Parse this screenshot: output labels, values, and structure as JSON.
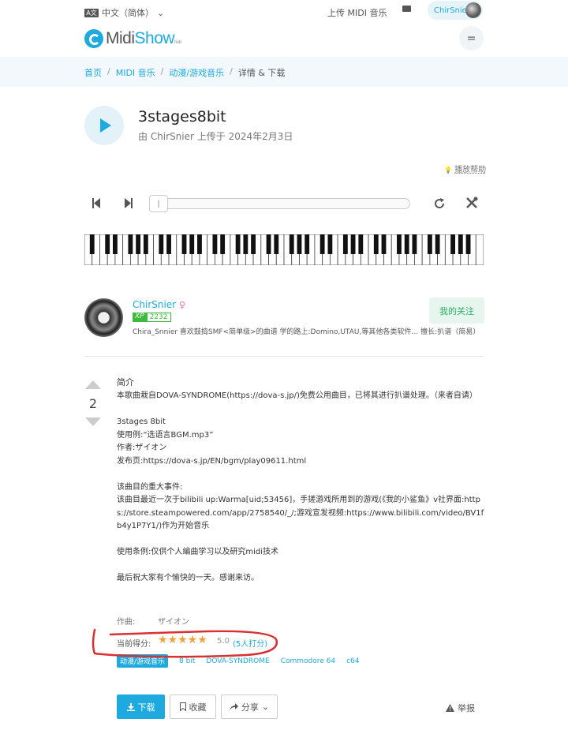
{
  "topbar": {
    "lang_icon": "A文",
    "lang_label": "中文（简体）",
    "lang_caret": "⌄",
    "upload_label": "上传 MIDI 音乐",
    "user_name": "ChirSnier"
  },
  "brand": {
    "name_a": "Midi",
    "name_b": "Show",
    "sub": "hub"
  },
  "menu_icon": "=",
  "breadcrumb": [
    "首页",
    "/",
    "MIDI 音乐",
    "/",
    "动漫/游戏音乐",
    "/",
    "详情 & 下载"
  ],
  "song": {
    "title": "3stages8bit",
    "byline": "由 ChirSnier 上传于 2024年2月3日"
  },
  "help_label": "播放帮助",
  "help_icon": "💡",
  "player": {
    "progress": 0.0,
    "white_keys": 52
  },
  "author": {
    "name": "ChirSnier",
    "gender_icon": "♀",
    "xp_tag": "XP",
    "xp_value": "2232",
    "desc": "Chira_Snnier 喜欢鼓捣SMF<简单级>的曲谱 学的路上:Domino,UTAU,等其他各类软件… 擅长:扒谱（简易）",
    "follow_label": "我的关注"
  },
  "vote_count": "2",
  "description": {
    "title": "简介",
    "body": "本歌曲栽自DOVA-SYNDROME(https://dova-s.jp/)免费公用曲目，已将其进行扒谱处理。（来者自请）\n\n3stages 8bit\n使用例:“选语言BGM.mp3”\n作者:ザイオン\n发布页:https://dova-s.jp/EN/bgm/play09611.html\n\n该曲目的重大事件:\n该曲目最近一次于bilibili up:Warma[uid;53456]，手搓游戏所用到的游戏(《我的小鲨鱼》v社界面:https://store.steampowered.com/app/2758540/_/;游戏宣发视频:https://www.bilibili.com/video/BV1fb4y1P7Y1/)作为开始音乐\n\n使用条例:仅供个人编曲学习以及研究midi技术\n\n最后祝大家有个愉快的一天。感谢来访。"
  },
  "composer": {
    "label": "作曲:",
    "value": "ザイオン"
  },
  "rating": {
    "label": "当前得分:",
    "stars": "★★★★★",
    "score": "5.0",
    "count": "(5人打分)"
  },
  "tags": [
    "动漫/游戏音乐",
    "8 bit",
    "DOVA-SYNDROME",
    "Commodore 64",
    "c64"
  ],
  "actions": {
    "download": "下载",
    "favorite": "收藏",
    "share": "分享",
    "share_caret": "⌄",
    "report": "举报"
  },
  "colors": {
    "accent": "#1eaade",
    "annotation": "#d93030",
    "follow": "#2ab063"
  }
}
